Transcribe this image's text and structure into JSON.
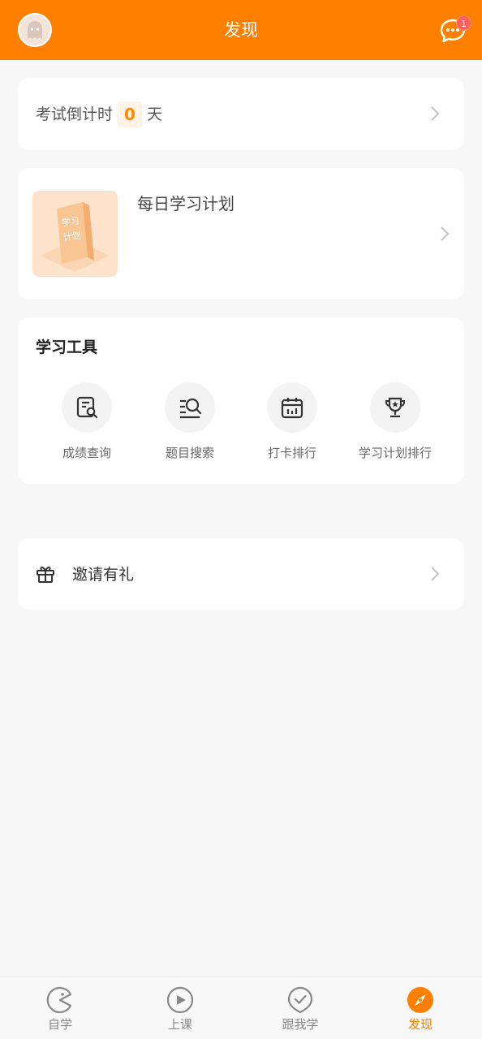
{
  "header": {
    "title": "发现",
    "message_badge": "1"
  },
  "countdown": {
    "label": "考试倒计时",
    "days": "0",
    "unit": "天"
  },
  "daily_plan": {
    "title": "每日学习计划",
    "cover_text": [
      "学习",
      "计划"
    ]
  },
  "tools": {
    "title": "学习工具",
    "items": [
      {
        "label": "成绩查询",
        "icon": "score-query-icon"
      },
      {
        "label": "题目搜索",
        "icon": "question-search-icon"
      },
      {
        "label": "打卡排行",
        "icon": "checkin-calendar-icon"
      },
      {
        "label": "学习计划排行",
        "icon": "trophy-icon"
      }
    ]
  },
  "invite": {
    "label": "邀请有礼",
    "icon": "gift-icon"
  },
  "bottom_nav": {
    "items": [
      {
        "label": "自学",
        "icon": "self-study-icon",
        "active": false
      },
      {
        "label": "上课",
        "icon": "play-icon",
        "active": false
      },
      {
        "label": "跟我学",
        "icon": "check-badge-icon",
        "active": false
      },
      {
        "label": "发现",
        "icon": "compass-icon",
        "active": true
      }
    ]
  },
  "colors": {
    "brand": "#ff7f00",
    "badge": "#ff5f5f",
    "background": "#f7f7f7"
  }
}
